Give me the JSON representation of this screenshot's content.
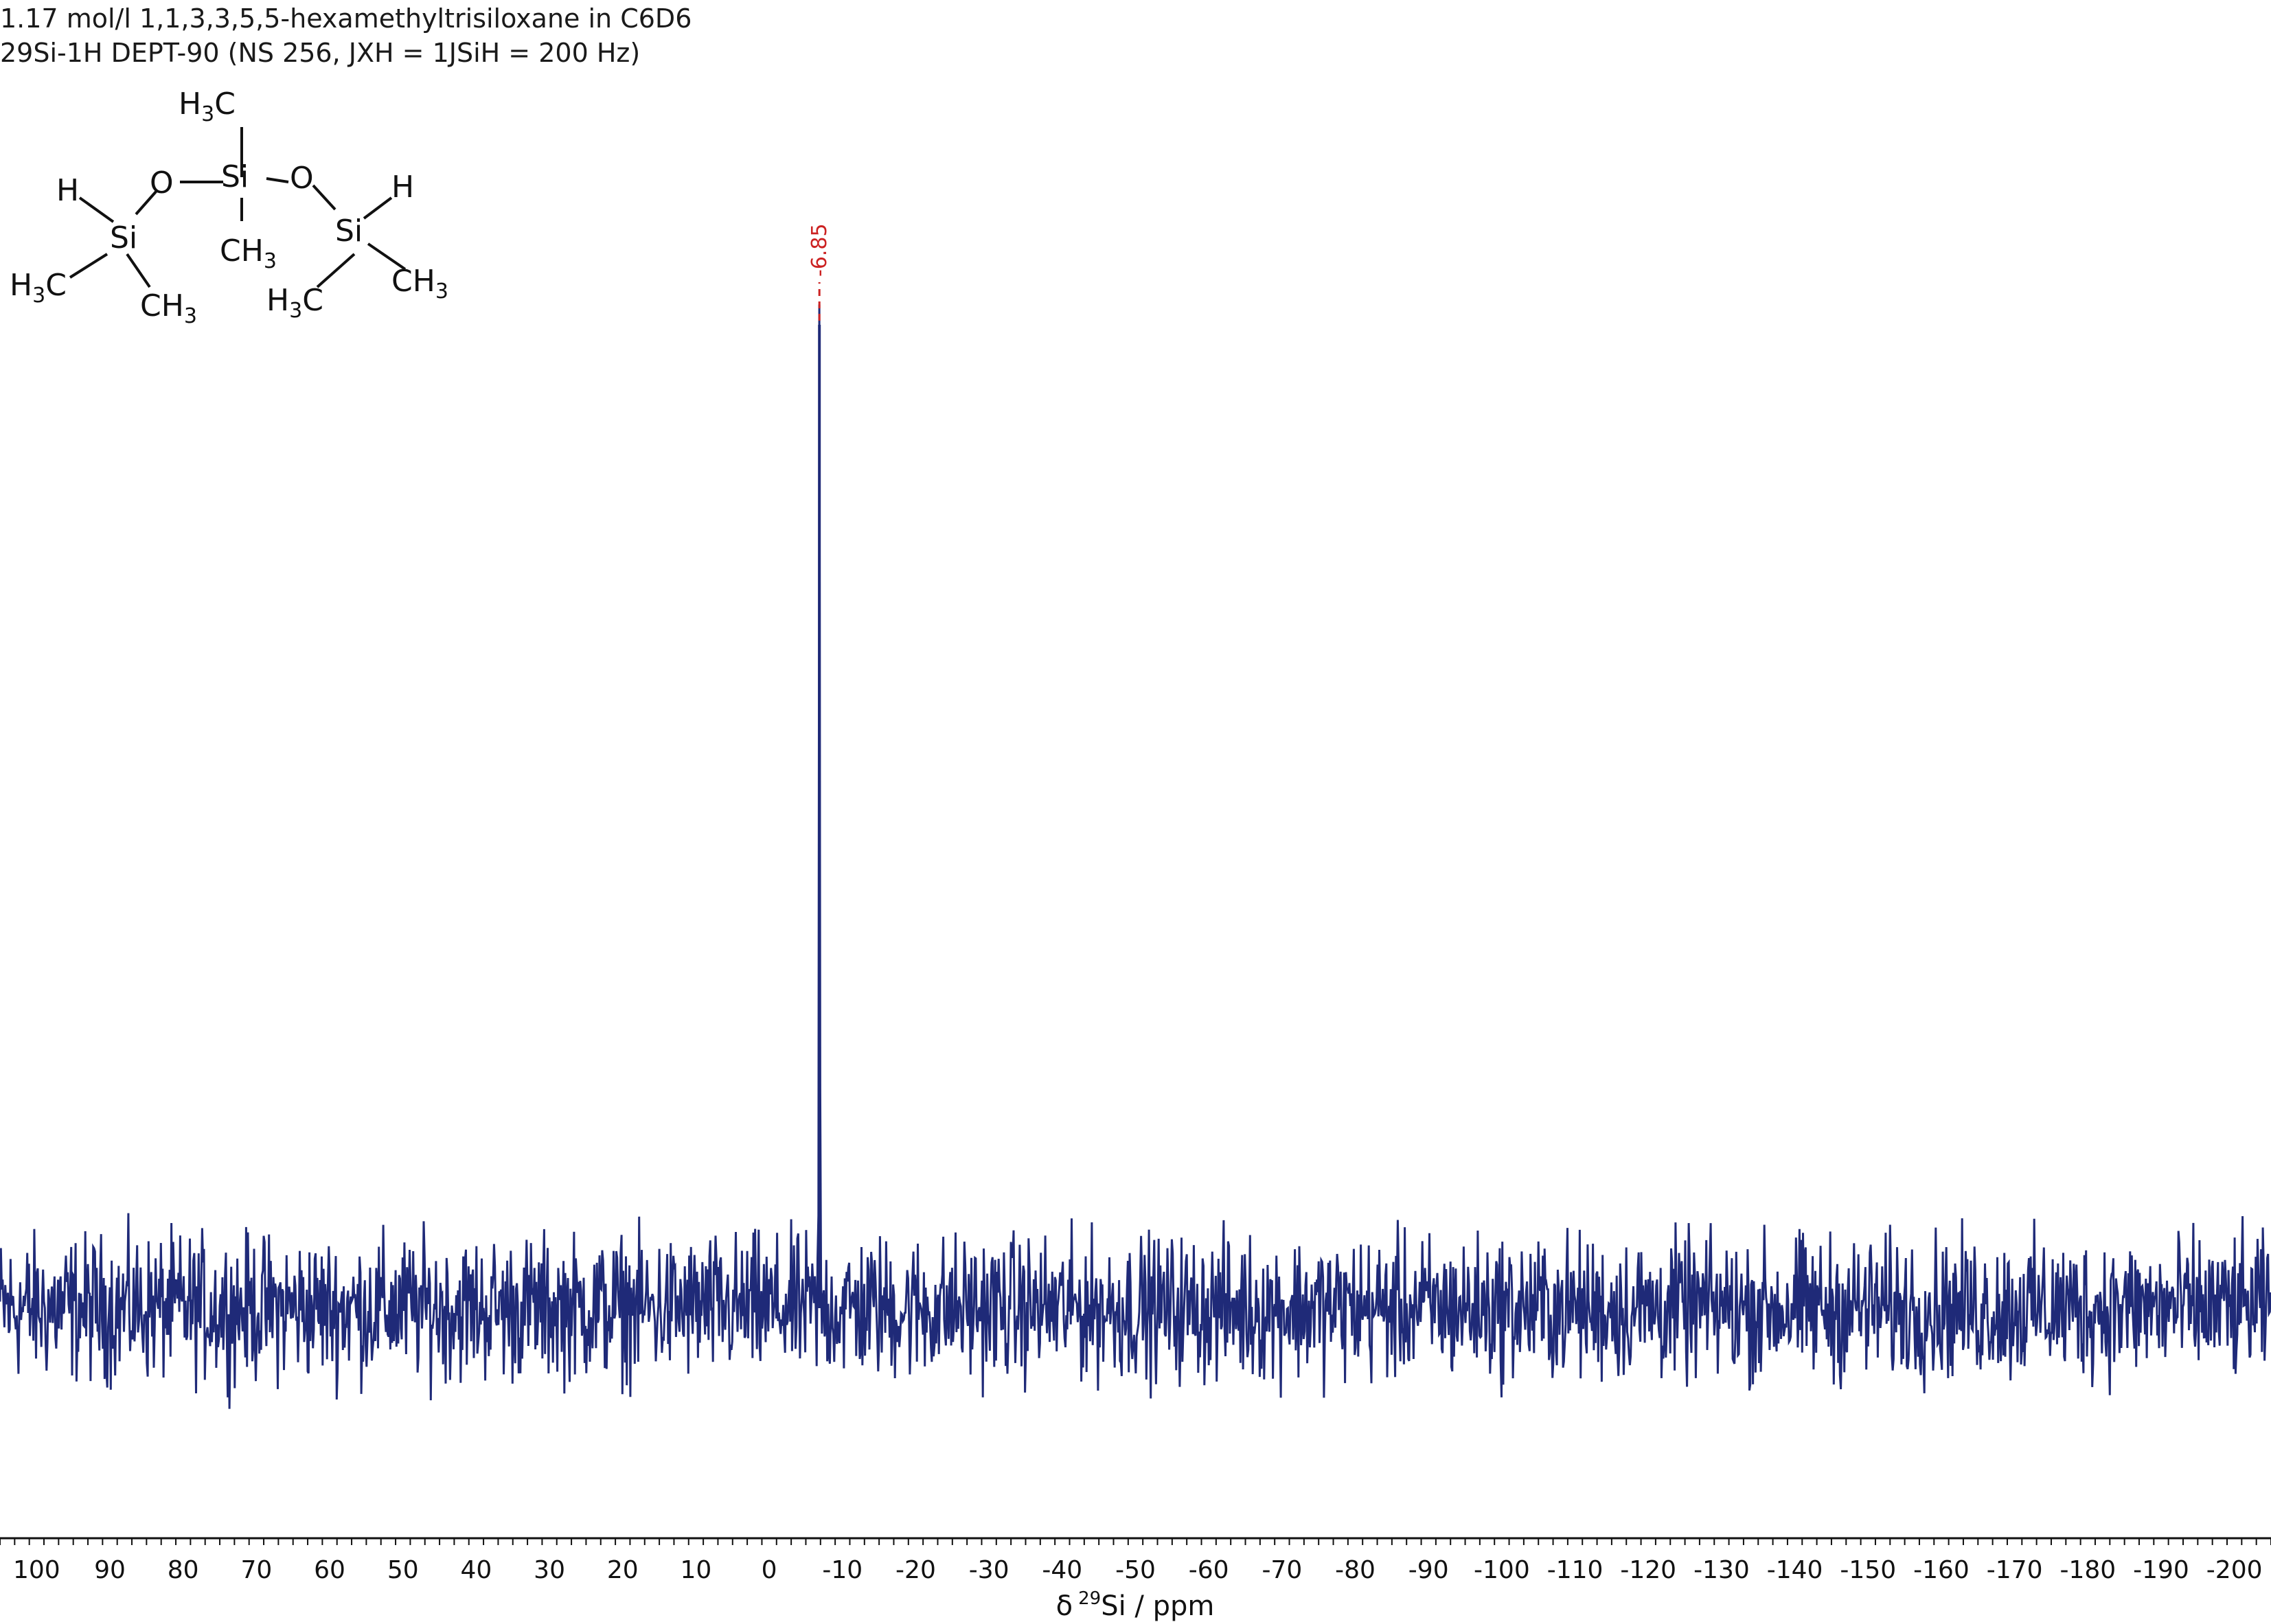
{
  "title_lines": [
    "1.17 mol/l 1,1,3,3,5,5-hexamethyltrisiloxane in C6D6",
    "29Si-1H DEPT-90 (NS 256, JXH = 1JSiH = 200 Hz)"
  ],
  "molecule": {
    "atoms": {
      "h_left": "H",
      "o_left": "O",
      "si_center": "Si",
      "o_right": "O",
      "h_right": "H",
      "si_left": "Si",
      "si_right": "Si",
      "ch3_top": "H3C",
      "ch3_center_bottom": "CH3",
      "ch3_left_a": "H3C",
      "ch3_left_b": "CH3",
      "ch3_right_a": "H3C",
      "ch3_right_b": "CH3"
    }
  },
  "chart_data": {
    "type": "line",
    "xlabel": "δ 29Si / ppm",
    "xlabel_parts": {
      "delta": "δ",
      "superscript": "29",
      "nucleus": "Si / ppm"
    },
    "xlim": [
      105,
      -205
    ],
    "x_reversed": true,
    "ticks": [
      100,
      90,
      80,
      70,
      60,
      50,
      40,
      30,
      20,
      10,
      0,
      -10,
      -20,
      -30,
      -40,
      -50,
      -60,
      -70,
      -80,
      -90,
      -100,
      -110,
      -120,
      -130,
      -140,
      -150,
      -160,
      -170,
      -180,
      -190,
      -200
    ],
    "tick_labels": [
      "100",
      "90",
      "80",
      "70",
      "60",
      "50",
      "40",
      "30",
      "20",
      "10",
      "0",
      "-10",
      "-20",
      "-30",
      "-40",
      "-50",
      "-60",
      "-70",
      "-80",
      "-90",
      "-100",
      "-110",
      "-120",
      "-130",
      "-140",
      "-150",
      "-160",
      "-170",
      "-180",
      "-190",
      "-200"
    ],
    "minor_tick_step": 2,
    "grid": false,
    "series": [
      {
        "color": "#1f2a78",
        "baseline": 0,
        "noise_amplitude": 0.045,
        "peaks": [
          {
            "x": -6.85,
            "y": 1.0,
            "label": "-6.85"
          }
        ]
      }
    ],
    "ylim": [
      -0.24,
      1.0
    ],
    "peak_label_color": "#cc2222"
  }
}
